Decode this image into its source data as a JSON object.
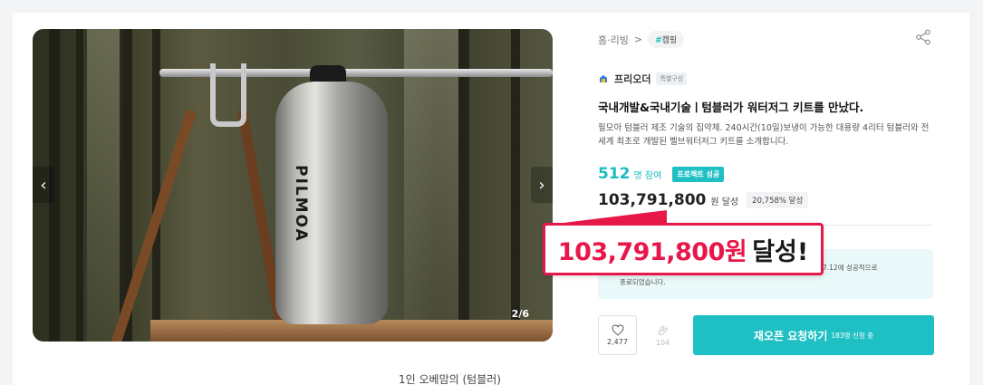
{
  "gallery": {
    "brand_text": "PILMOA",
    "counter": "2/6",
    "prev_icon": "chevron-left",
    "next_icon": "chevron-right"
  },
  "breadcrumb": {
    "category": "홈·리빙",
    "separator": ">",
    "tag_hash": "#",
    "tag": "캠핑"
  },
  "maker": {
    "name": "프리오더",
    "badge": "특별구성"
  },
  "project": {
    "title": "국내개발&국내기술ㅣ텀블러가 워터저그 키트를 만났다.",
    "description": "필모아 텀블러 제조 기술의 집약체. 240시간(10일)보냉이 가능한 대용량 4리터 텀블러와 전세계 최초로 개발된 벨브워터저그 키트를 소개합니다."
  },
  "stats": {
    "participants": "512",
    "participants_unit": "명 참여",
    "success_badge": "프로젝트 성공",
    "amount": "103,791,800",
    "amount_unit": "원 달성",
    "percent": "20,758% 달성"
  },
  "notice": {
    "line1": "7.12에 성공적으로",
    "line2": "종료되었습니다."
  },
  "overlay": {
    "amount": "103,791,800원",
    "suffix": "달성!"
  },
  "actions": {
    "like_count": "2,477",
    "cheer_count": "104",
    "cta_label": "재오픈 요청하기",
    "cta_sub": "183명 신청 중"
  },
  "bottom": {
    "peek_text": "1인 오베맘의 (텀블러)"
  },
  "colors": {
    "accent": "#1fc0c4",
    "highlight": "#e8174a"
  }
}
